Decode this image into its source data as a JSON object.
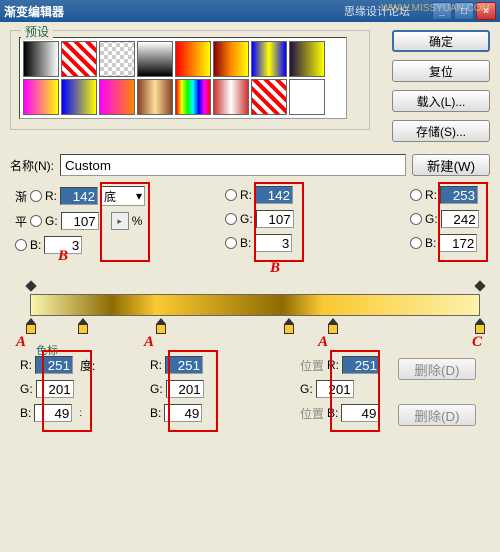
{
  "title": "渐变编辑器",
  "watermark": "思缘设计论坛",
  "watermark2": "WWW.MISSYUAN.COM",
  "titlebar": {
    "min": "_",
    "max": "□",
    "close": "×"
  },
  "presets_label": "预设",
  "buttons": {
    "ok": "确定",
    "reset": "复位",
    "load": "载入(L)...",
    "save": "存储(S)..."
  },
  "name": {
    "label": "名称(N):",
    "value": "Custom",
    "new": "新建(W)"
  },
  "top": {
    "left_label": "渐",
    "type_value": "底",
    "mid_label": "平",
    "pct": "%",
    "b1": {
      "r": "142",
      "g": "107",
      "b": "3"
    },
    "b2": {
      "r": "142",
      "g": "107",
      "b": "3"
    },
    "c": {
      "r": "253",
      "g": "242",
      "b": "172"
    }
  },
  "bot": {
    "label": "色标",
    "deg": "度:",
    "pos": "位置",
    "pos2": "位置",
    "del": "删除(D)",
    "a1": {
      "r": "251",
      "g": "201",
      "b": "49"
    },
    "a2": {
      "r": "251",
      "g": "201",
      "b": "49"
    },
    "a3": {
      "r": "251",
      "g": "201",
      "b": "49"
    }
  },
  "ann": {
    "a": "A",
    "b": "B",
    "c": "C"
  },
  "swatches": [
    "linear-gradient(to right,#000,#fff)",
    "repeating-linear-gradient(45deg,#f00,#f00 4px,#fff 4px,#fff 8px)",
    "repeating-conic-gradient(#ccc 0 25%,#fff 0 50%) 0/8px 8px",
    "linear-gradient(to bottom,#fff,#000)",
    "linear-gradient(to right,#f00,#ff0)",
    "linear-gradient(to right,#800,#f80,#ff0)",
    "linear-gradient(to right,#00f,#ff0,#00f)",
    "linear-gradient(to right,#214,#ff0)",
    "linear-gradient(to right,#f0f,#ff0)",
    "linear-gradient(to right,#00f,#ff0)",
    "linear-gradient(to right,#f0f,#f80)",
    "linear-gradient(to right,#842,#fd9,#842)",
    "linear-gradient(to right,#f00,#ff0,#0f0,#0ff,#00f,#f0f,#f00)",
    "linear-gradient(to right,#c33,#fff,#c33)",
    "repeating-linear-gradient(45deg,#f00,#f00 4px,#fff 4px,#fff 8px)",
    "#fff"
  ]
}
